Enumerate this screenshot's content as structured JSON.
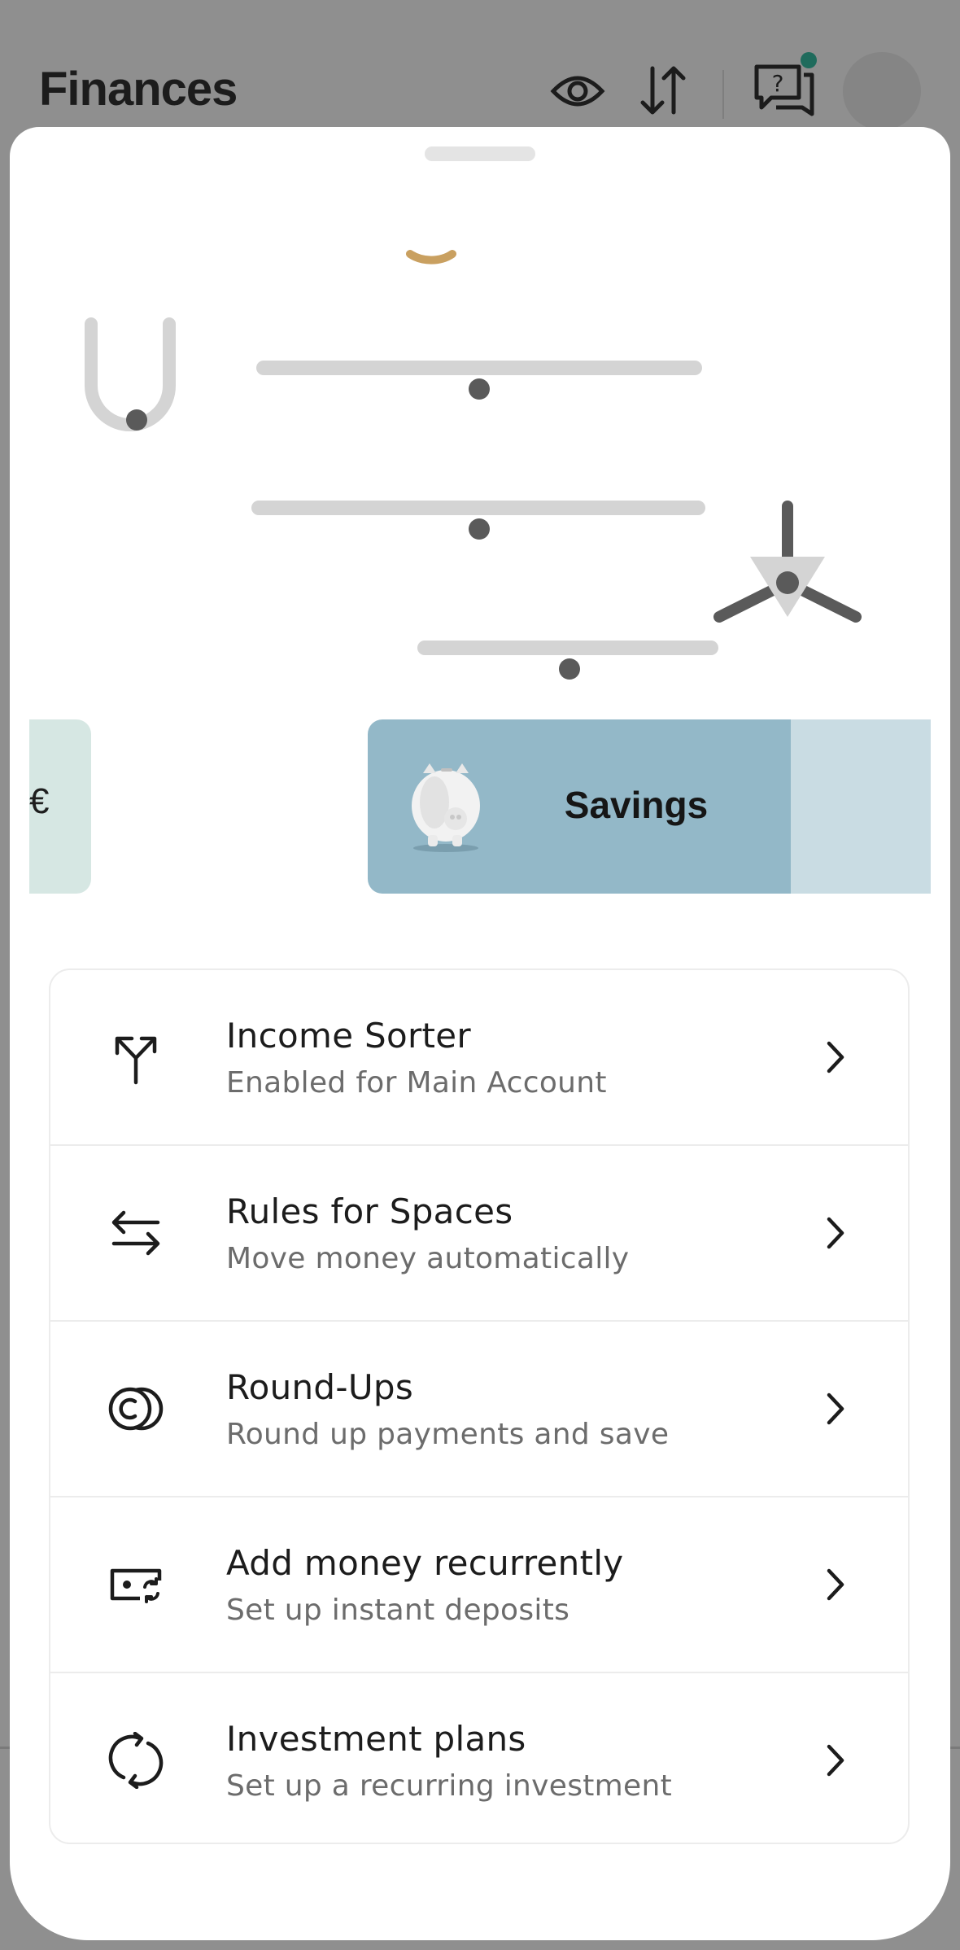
{
  "background": {
    "title": "Finances",
    "icons": [
      "eye-icon",
      "sort-arrows-icon",
      "help-chat-icon",
      "avatar"
    ]
  },
  "carousel": {
    "left_card_text": "€",
    "savings_label": "Savings"
  },
  "list": {
    "items": [
      {
        "title": "Income Sorter",
        "subtitle": "Enabled for Main Account",
        "icon": "split-arrow-icon"
      },
      {
        "title": "Rules for Spaces",
        "subtitle": "Move money automatically",
        "icon": "transfer-arrows-icon"
      },
      {
        "title": "Round-Ups",
        "subtitle": "Round up payments and save",
        "icon": "coins-icon"
      },
      {
        "title": "Add money recurrently",
        "subtitle": "Set up instant deposits",
        "icon": "recurring-deposit-icon"
      },
      {
        "title": "Investment plans",
        "subtitle": "Set up a recurring investment",
        "icon": "refresh-icon"
      }
    ]
  },
  "colors": {
    "overlay": "#8f8f8f",
    "savings_card": "#93b8c8",
    "left_card": "#d6e7e3",
    "notification_dot": "#1f6b5c"
  }
}
